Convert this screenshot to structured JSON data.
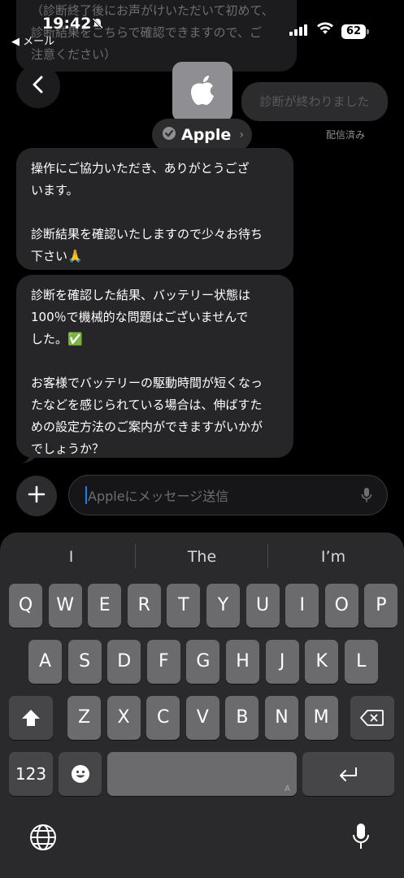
{
  "status_bar": {
    "time": "19:42",
    "back_app": "◀ メール",
    "battery": "62"
  },
  "conversation": {
    "top_message_partial": "（診断終了後にお声がけいただいて初めて、\n診断結果をこちらで確認できますので、ご\n注意ください）",
    "contact_name": "Apple",
    "sent_message": "診断が終わりました",
    "sent_status": "配信済み",
    "messages": [
      "操作にご協力いただき、ありがとうござ\nいます。\n\n診断結果を確認いたしますので少々お待ち\n下さい🙏",
      "診断を確認した結果、バッテリー状態は\n100％で機械的な問題はございませんで\nした。✅\n\nお客様でバッテリーの駆動時間が短くなっ\nたなどを感じられている場合は、伸ばすた\nめの設定方法のご案内ができますがいかが\nでしょうか？"
    ]
  },
  "composer": {
    "placeholder": "Appleにメッセージ送信"
  },
  "keyboard": {
    "suggestions": [
      "I",
      "The",
      "I’m"
    ],
    "row1": [
      "Q",
      "W",
      "E",
      "R",
      "T",
      "Y",
      "U",
      "I",
      "O",
      "P"
    ],
    "row2": [
      "A",
      "S",
      "D",
      "F",
      "G",
      "H",
      "J",
      "K",
      "L"
    ],
    "row3": [
      "Z",
      "X",
      "C",
      "V",
      "B",
      "N",
      "M"
    ],
    "numbers_key": "123",
    "space_corner": "A"
  },
  "icons": [
    "back-chevron-icon",
    "apple-logo-icon",
    "verified-badge-icon",
    "plus-icon",
    "microphone-icon",
    "shift-icon",
    "delete-icon",
    "emoji-icon",
    "return-icon",
    "globe-icon",
    "signal-icon",
    "wifi-icon",
    "bell-slash-icon"
  ]
}
